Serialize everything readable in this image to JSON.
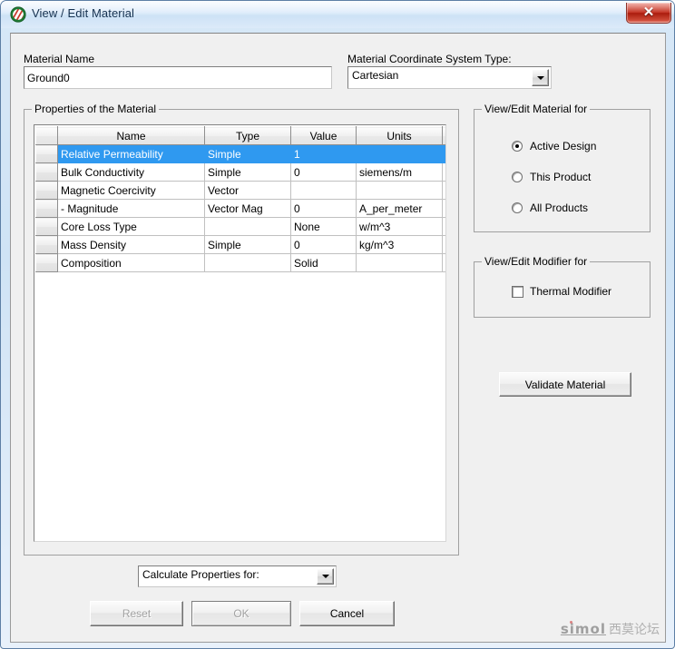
{
  "window": {
    "title": "View / Edit Material",
    "app_icon": "maxwell-material-icon",
    "close_label": "✕"
  },
  "material_name": {
    "label": "Material Name",
    "value": "Ground0"
  },
  "coordinate_system": {
    "label": "Material Coordinate System Type:",
    "value": "Cartesian"
  },
  "properties_group": {
    "title": "Properties of the Material",
    "columns": [
      "",
      "Name",
      "Type",
      "Value",
      "Units"
    ],
    "rows": [
      {
        "name": "Relative Permeability",
        "type": "Simple",
        "value": "1",
        "units": "",
        "selected": true
      },
      {
        "name": "Bulk Conductivity",
        "type": "Simple",
        "value": "0",
        "units": "siemens/m",
        "selected": false
      },
      {
        "name": "Magnetic Coercivity",
        "type": "Vector",
        "value": "",
        "units": "",
        "selected": false
      },
      {
        "name": "-  Magnitude",
        "type": "Vector Mag",
        "value": "0",
        "units": "A_per_meter",
        "selected": false
      },
      {
        "name": "Core Loss Type",
        "type": "",
        "value": "None",
        "units": "w/m^3",
        "selected": false
      },
      {
        "name": "Mass Density",
        "type": "Simple",
        "value": "0",
        "units": "kg/m^3",
        "selected": false
      },
      {
        "name": "Composition",
        "type": "",
        "value": "Solid",
        "units": "",
        "selected": false
      }
    ]
  },
  "view_edit_material_for": {
    "title": "View/Edit Material for",
    "options": [
      {
        "label": "Active Design",
        "selected": true
      },
      {
        "label": "This Product",
        "selected": false
      },
      {
        "label": "All Products",
        "selected": false
      }
    ]
  },
  "view_edit_modifier_for": {
    "title": "View/Edit Modifier for",
    "options": [
      {
        "label": "Thermal Modifier",
        "checked": false
      }
    ]
  },
  "validate_button": {
    "label": "Validate Material"
  },
  "calculate_properties": {
    "value": "Calculate Properties for:"
  },
  "footer_buttons": {
    "reset": "Reset",
    "ok": "OK",
    "cancel": "Cancel"
  },
  "watermark": {
    "brand": "simol",
    "chinese": "西莫论坛"
  }
}
